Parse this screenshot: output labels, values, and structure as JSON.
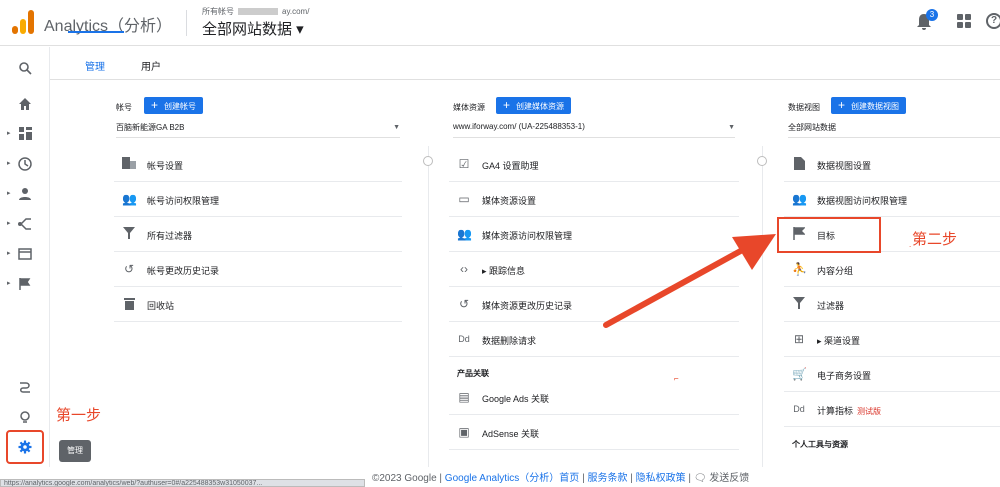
{
  "header": {
    "app_title": "Analytics（分析）",
    "account_label": "所有帐号",
    "account_suffix": "ay.com/",
    "property_title": "全部网站数据",
    "notification_count": "3"
  },
  "nav_tabs": {
    "admin": "管理",
    "user": "用户"
  },
  "account_col": {
    "label": "帐号",
    "create_button": "创建帐号",
    "selected": "百脑新能源GA B2B",
    "items": [
      {
        "icon": "building-icon",
        "label": "帐号设置"
      },
      {
        "icon": "people-icon",
        "label": "帐号访问权限管理"
      },
      {
        "icon": "filter-icon",
        "label": "所有过滤器"
      },
      {
        "icon": "history-icon",
        "label": "帐号更改历史记录"
      },
      {
        "icon": "trash-icon",
        "label": "回收站"
      }
    ]
  },
  "property_col": {
    "label": "媒体资源",
    "create_button": "创建媒体资源",
    "selected": "www.iforway.com/ (UA-225488353-1)",
    "items": [
      {
        "icon": "checkbox-icon",
        "label": "GA4 设置助理"
      },
      {
        "icon": "window-icon",
        "label": "媒体资源设置"
      },
      {
        "icon": "people-icon",
        "label": "媒体资源访问权限管理"
      },
      {
        "icon": "code-icon",
        "label": "跟踪信息"
      },
      {
        "icon": "history-icon",
        "label": "媒体资源更改历史记录"
      },
      {
        "icon": "dd-icon",
        "label": "数据删除请求"
      }
    ],
    "product_section": "产品关联",
    "product_items": [
      {
        "icon": "ads-icon",
        "label": "Google Ads 关联"
      },
      {
        "icon": "adsense-icon",
        "label": "AdSense 关联"
      }
    ]
  },
  "view_col": {
    "label": "数据视图",
    "create_button": "创建数据视图",
    "selected": "全部网站数据",
    "items": [
      {
        "icon": "doc-icon",
        "label": "数据视图设置"
      },
      {
        "icon": "people-icon",
        "label": "数据视图访问权限管理"
      },
      {
        "icon": "flag-icon",
        "label": "目标"
      },
      {
        "icon": "person-icon",
        "label": "内容分组"
      },
      {
        "icon": "filter-icon",
        "label": "过滤器"
      },
      {
        "icon": "channel-icon",
        "label": "渠道设置"
      },
      {
        "icon": "cart-icon",
        "label": "电子商务设置"
      },
      {
        "icon": "dd-icon",
        "label": "计算指标",
        "beta": "测试版"
      }
    ],
    "personal_section": "个人工具与资源"
  },
  "annotations": {
    "step1": "第一步",
    "step2": "第二步",
    "tooltip": "管理"
  },
  "footer": {
    "copyright": "©2023 Google |",
    "ga_link": "Google Analytics（分析）首页",
    "terms": "服务条款",
    "privacy": "隐私权政策",
    "feedback": "发送反馈",
    "status_url": "https://analytics.google.com/analytics/web/?authuser=0#/a225488353w31050037..."
  },
  "colors": {
    "accent": "#1a73e8",
    "annotation": "#e8472a"
  }
}
